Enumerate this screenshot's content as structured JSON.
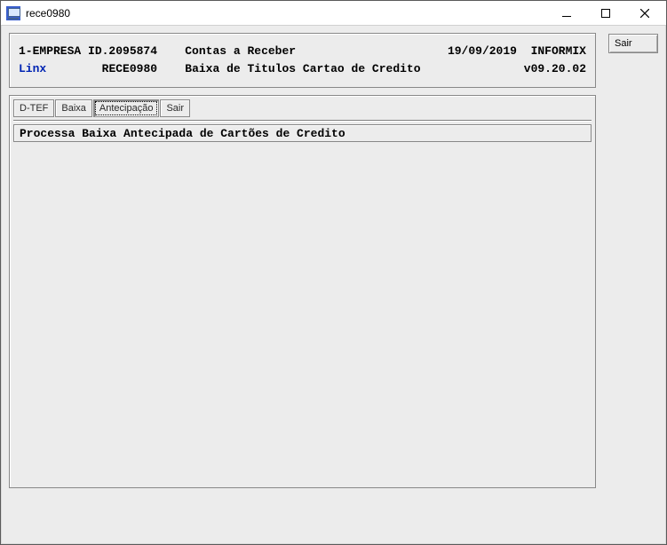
{
  "window": {
    "title": "rece0980"
  },
  "header": {
    "line1": {
      "company": "1-EMPRESA ID.2095874",
      "module": "Contas a Receber",
      "date": "19/09/2019",
      "system": "INFORMIX"
    },
    "line2": {
      "vendor": "Linx",
      "program": "RECE0980",
      "title": "Baixa de Titulos Cartao de Credito",
      "version": "v09.20.02"
    }
  },
  "menu": {
    "items": [
      "D-TEF",
      "Baixa",
      "Antecipação",
      "Sair"
    ],
    "active_index": 2
  },
  "status": {
    "text": "Processa Baixa Antecipada de Cartões de Credito"
  },
  "side": {
    "sair_label": "Sair"
  }
}
